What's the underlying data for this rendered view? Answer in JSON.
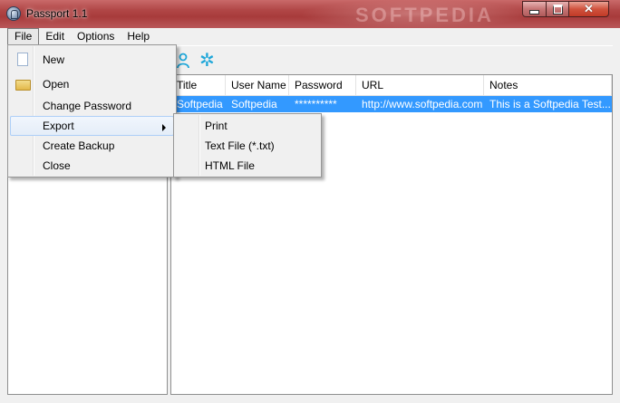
{
  "window": {
    "title": "Passport 1.1",
    "watermark": "SOFTPEDIA"
  },
  "menubar": {
    "items": [
      {
        "label": "File"
      },
      {
        "label": "Edit"
      },
      {
        "label": "Options"
      },
      {
        "label": "Help"
      }
    ]
  },
  "file_menu": {
    "items": [
      {
        "label": "New"
      },
      {
        "label": "Open"
      },
      {
        "label": "Change Password"
      },
      {
        "label": "Export"
      },
      {
        "label": "Create Backup"
      },
      {
        "label": "Close"
      }
    ]
  },
  "export_submenu": {
    "items": [
      {
        "label": "Print"
      },
      {
        "label": "Text File (*.txt)"
      },
      {
        "label": "HTML File"
      }
    ]
  },
  "grid": {
    "columns": [
      "Title",
      "User Name",
      "Password",
      "URL",
      "Notes"
    ],
    "rows": [
      {
        "title": "Softpedia",
        "user_name": "Softpedia",
        "password": "**********",
        "url": "http://www.softpedia.com",
        "notes": "This is a Softpedia Test..."
      }
    ]
  },
  "colors": {
    "selection": "#3399ff",
    "titlebar": "#b14747",
    "toolbar_icon": "#1fa7d9"
  },
  "icons": {
    "app": "passport-icon",
    "new": "new-document-icon",
    "open": "open-folder-icon",
    "toolbar_1": "person-icon",
    "toolbar_2": "gear-icon"
  }
}
